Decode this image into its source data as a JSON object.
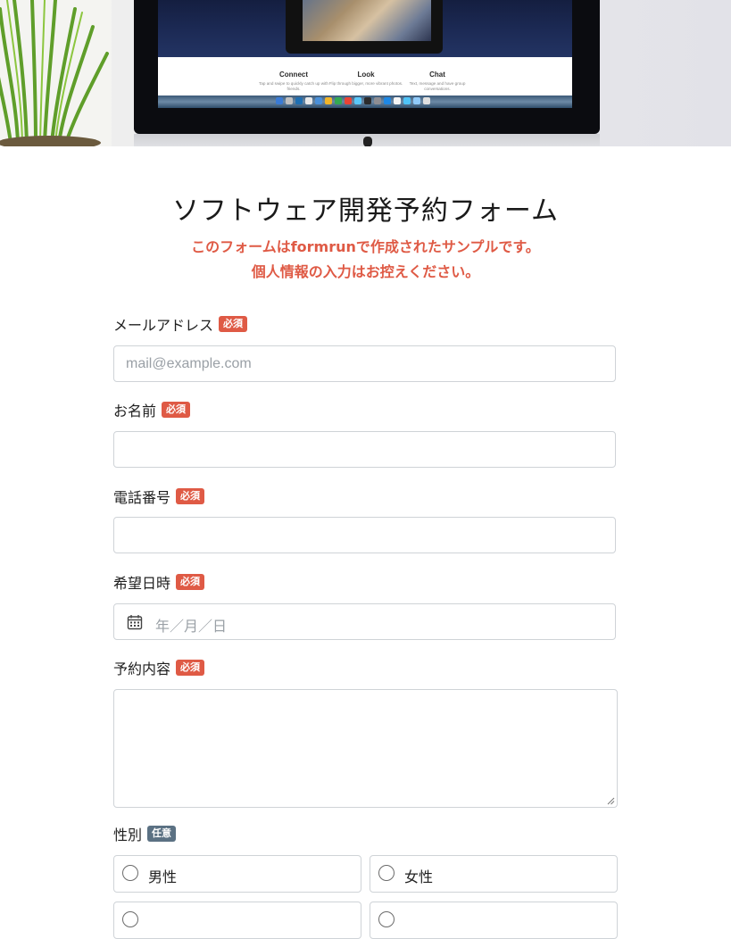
{
  "hero": {
    "features": [
      {
        "title": "Connect",
        "desc": "Tap and swipe to quickly catch up with friends."
      },
      {
        "title": "Look",
        "desc": "Flip through bigger, more vibrant photos."
      },
      {
        "title": "Chat",
        "desc": "Text, message and have group conversations."
      }
    ]
  },
  "form": {
    "title": "ソフトウェア開発予約フォーム",
    "notice_line1": "このフォームはformrunで作成されたサンプルです。",
    "notice_line2": "個人情報の入力はお控えください。",
    "colors": {
      "required": "#df5a45",
      "optional": "#5b7183",
      "border": "#cfd3d7"
    },
    "required_badge": "必須",
    "optional_badge": "任意",
    "fields": {
      "email": {
        "label": "メールアドレス",
        "value": "",
        "placeholder": "mail@example.com"
      },
      "name": {
        "label": "お名前",
        "value": ""
      },
      "phone": {
        "label": "電話番号",
        "value": ""
      },
      "datetime": {
        "label": "希望日時",
        "placeholder": "年／月／日",
        "icon": "calendar-icon"
      },
      "details": {
        "label": "予約内容",
        "value": ""
      },
      "gender": {
        "label": "性別",
        "options": [
          "男性",
          "女性"
        ]
      }
    }
  }
}
